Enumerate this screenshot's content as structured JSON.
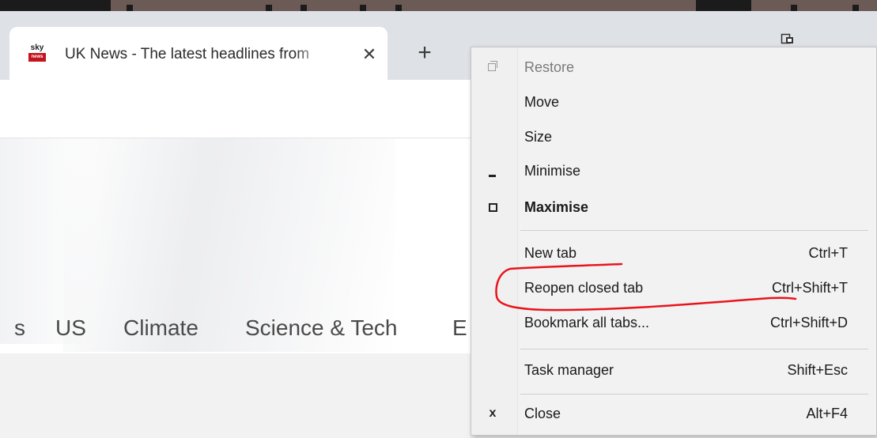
{
  "browser": {
    "tab": {
      "favicon_top": "sky",
      "favicon_bottom": "news",
      "title": "UK News - The latest headlines from",
      "close_glyph": "✕"
    },
    "new_tab_glyph": "+",
    "window_icon": "window-restore-icon"
  },
  "page": {
    "nav_items": [
      "s",
      "US",
      "Climate",
      "Science & Tech",
      "E"
    ]
  },
  "menu": {
    "items": [
      {
        "label": "Restore",
        "shortcut": "",
        "state": "disabled",
        "icon": "restore-icon"
      },
      {
        "label": "Move",
        "shortcut": ""
      },
      {
        "label": "Size",
        "shortcut": ""
      },
      {
        "label": "Minimise",
        "shortcut": "",
        "icon": "minimise-icon"
      },
      {
        "label": "Maximise",
        "shortcut": "",
        "state": "bold",
        "icon": "maximise-icon"
      },
      {
        "label": "New tab",
        "shortcut": "Ctrl+T"
      },
      {
        "label": "Reopen closed tab",
        "shortcut": "Ctrl+Shift+T"
      },
      {
        "label": "Bookmark all tabs...",
        "shortcut": "Ctrl+Shift+D"
      },
      {
        "label": "Task manager",
        "shortcut": "Shift+Esc"
      },
      {
        "label": "Close",
        "shortcut": "Alt+F4",
        "icon": "close-icon",
        "glyph": "x"
      }
    ]
  },
  "annotation": {
    "color": "#e8141c"
  }
}
